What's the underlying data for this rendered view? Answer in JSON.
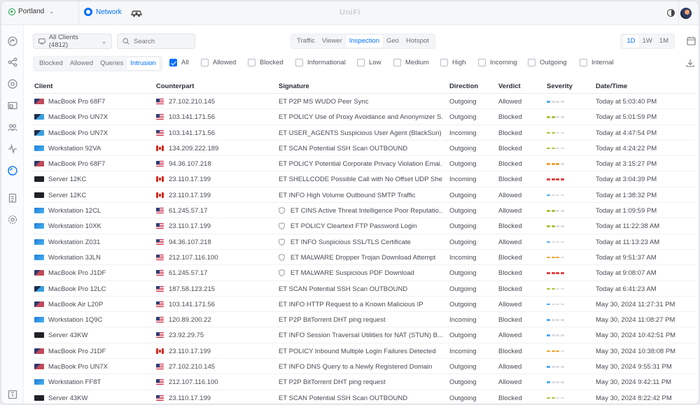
{
  "site": {
    "name": "Portland"
  },
  "app": {
    "tab_label": "Network",
    "brand": "UniFi"
  },
  "filters": {
    "clients_label": "All Clients (4812)",
    "search_placeholder": "Search",
    "main_tabs": [
      {
        "label": "Traffic",
        "active": false
      },
      {
        "label": "Viewer",
        "active": false
      },
      {
        "label": "Inspection",
        "active": true
      },
      {
        "label": "Geo",
        "active": false
      },
      {
        "label": "Hotspot",
        "active": false
      }
    ],
    "time_ranges": [
      {
        "label": "1D",
        "active": true
      },
      {
        "label": "1W",
        "active": false
      },
      {
        "label": "1M",
        "active": false
      }
    ],
    "verdict_tabs": [
      {
        "label": "Blocked",
        "active": false
      },
      {
        "label": "Allowed",
        "active": false
      },
      {
        "label": "Queries",
        "active": false
      },
      {
        "label": "Intrusion",
        "active": true
      }
    ],
    "checkboxes": [
      {
        "label": "All",
        "checked": true
      },
      {
        "label": "Allowed",
        "checked": false
      },
      {
        "label": "Blocked",
        "checked": false
      },
      {
        "label": "Informational",
        "checked": false
      },
      {
        "label": "Low",
        "checked": false
      },
      {
        "label": "Medium",
        "checked": false
      },
      {
        "label": "High",
        "checked": false
      },
      {
        "label": "Incoming",
        "checked": false
      },
      {
        "label": "Outgoing",
        "checked": false
      },
      {
        "label": "Internal",
        "checked": false
      }
    ]
  },
  "table": {
    "headers": [
      "Client",
      "Counterpart",
      "Signature",
      "Direction",
      "Verdict",
      "Severity",
      "Date/Time"
    ],
    "severity_colors": {
      "low": "#4aa8f0",
      "medium": "#a9c23c",
      "high": "#f0a02c",
      "critical": "#e23c3c",
      "empty": "#d9dde2"
    },
    "device_colors": {
      "macbook": "#b23a5a",
      "macbook_blue": "#2c6db5",
      "workstation": "#2d8fe0",
      "server": "#1f2328"
    },
    "rows": [
      {
        "client": "MacBook Pro 68F7",
        "device": "macbook",
        "flag": "us",
        "ip": "27.102.210.145",
        "shield": false,
        "signature": "ET P2P MS WUDO Peer Sync",
        "direction": "Outgoing",
        "verdict": "Allowed",
        "severity": "low",
        "time": "Today at 5:03:40 PM"
      },
      {
        "client": "MacBook Pro UN7X",
        "device": "macbook_blue",
        "flag": "us",
        "ip": "103.141.171.56",
        "shield": false,
        "signature": "ET POLICY Use of Proxy Avoidance and Anonymizer S...",
        "direction": "Outgoing",
        "verdict": "Blocked",
        "severity": "medium",
        "time": "Today at 5:01:59 PM"
      },
      {
        "client": "MacBook Pro UN7X",
        "device": "macbook_blue",
        "flag": "us",
        "ip": "103.141.171.56",
        "shield": false,
        "signature": "ET USER_AGENTS Suspicious User Agent (BlackSun)",
        "direction": "Incoming",
        "verdict": "Blocked",
        "severity": "medium",
        "time": "Today at 4:47:54 PM"
      },
      {
        "client": "Workstation 92VA",
        "device": "workstation",
        "flag": "ca",
        "ip": "134.209.222.189",
        "shield": false,
        "signature": "ET SCAN Potential SSH Scan OUTBOUND",
        "direction": "Outgoing",
        "verdict": "Blocked",
        "severity": "medium",
        "time": "Today at 4:24:22 PM"
      },
      {
        "client": "MacBook Pro 68F7",
        "device": "macbook",
        "flag": "us",
        "ip": "94.36.107.218",
        "shield": false,
        "signature": "ET POLICY Potential Corporate Privacy Violation Emai...",
        "direction": "Outgoing",
        "verdict": "Blocked",
        "severity": "high",
        "time": "Today at 3:15:27 PM"
      },
      {
        "client": "Server 12KC",
        "device": "server",
        "flag": "ca",
        "ip": "23.110.17.199",
        "shield": false,
        "signature": "ET SHELLCODE Possible Call with No Offset UDP She...",
        "direction": "Incoming",
        "verdict": "Blocked",
        "severity": "critical",
        "time": "Today at 3:04:39 PM"
      },
      {
        "client": "Server 12KC",
        "device": "server",
        "flag": "ca",
        "ip": "23.110.17.199",
        "shield": false,
        "signature": "ET INFO High Volume Outbound SMTP Traffic",
        "direction": "Outgoing",
        "verdict": "Allowed",
        "severity": "low",
        "time": "Today at 1:38:32 PM"
      },
      {
        "client": "Workstation 12CL",
        "device": "workstation",
        "flag": "us",
        "ip": "61.245.57.17",
        "shield": true,
        "signature": "ET CINS Active Threat Intelligence Poor Reputatio...",
        "direction": "Outgoing",
        "verdict": "Allowed",
        "severity": "medium",
        "time": "Today at 1:09:59 PM"
      },
      {
        "client": "Workstation 10XK",
        "device": "workstation",
        "flag": "us",
        "ip": "23.110.17.199",
        "shield": true,
        "signature": "ET POLICY Cleartext FTP Password Login",
        "direction": "Outgoing",
        "verdict": "Blocked",
        "severity": "medium",
        "time": "Today at 11:22:38 AM"
      },
      {
        "client": "Workstation Z031",
        "device": "workstation",
        "flag": "us",
        "ip": "94.36.107.218",
        "shield": true,
        "signature": "ET INFO Suspicious SSL/TLS Certificate",
        "direction": "Outgoing",
        "verdict": "Allowed",
        "severity": "low",
        "time": "Today at 11:13:23 AM"
      },
      {
        "client": "Workstation 3JLN",
        "device": "workstation",
        "flag": "us",
        "ip": "212.107.116.100",
        "shield": true,
        "signature": "ET MALWARE Dropper Trojan Download Attempt",
        "direction": "Incoming",
        "verdict": "Blocked",
        "severity": "high",
        "time": "Today at 9:51:37 AM"
      },
      {
        "client": "MacBook Pro J1DF",
        "device": "macbook",
        "flag": "us",
        "ip": "61.245.57.17",
        "shield": true,
        "signature": "ET MALWARE Suspicious PDF Download",
        "direction": "Outgoing",
        "verdict": "Blocked",
        "severity": "critical",
        "time": "Today at 9:08:07 AM"
      },
      {
        "client": "MacBook Pro 12LC",
        "device": "macbook_blue",
        "flag": "us",
        "ip": "187.58.123.215",
        "shield": false,
        "signature": "ET SCAN Potential SSH Scan OUTBOUND",
        "direction": "Outgoing",
        "verdict": "Blocked",
        "severity": "medium",
        "time": "Today at 6:41:23 AM"
      },
      {
        "client": "MacBook Air L20P",
        "device": "macbook",
        "flag": "us",
        "ip": "103.141.171.56",
        "shield": false,
        "signature": "ET INFO HTTP Request to a Known Malicious IP",
        "direction": "Outgoing",
        "verdict": "Allowed",
        "severity": "low",
        "time": "May 30, 2024 11:27:31 PM"
      },
      {
        "client": "Workstation 1Q9C",
        "device": "workstation",
        "flag": "us",
        "ip": "120.89.200.22",
        "shield": false,
        "signature": "ET P2P BitTorrent DHT ping request",
        "direction": "Incoming",
        "verdict": "Blocked",
        "severity": "low",
        "time": "May 30, 2024 11:08:27 PM"
      },
      {
        "client": "Server 43KW",
        "device": "server",
        "flag": "us",
        "ip": "23.92.29.75",
        "shield": false,
        "signature": "ET INFO Session Traversal Utilities for NAT (STUN) B...",
        "direction": "Outgoing",
        "verdict": "Allowed",
        "severity": "low",
        "time": "May 30, 2024 10:42:51 PM"
      },
      {
        "client": "MacBook Pro J1DF",
        "device": "macbook",
        "flag": "ca",
        "ip": "23.110.17.199",
        "shield": false,
        "signature": "ET POLICY Inbound Multiple Login Failures Detected",
        "direction": "Incoming",
        "verdict": "Blocked",
        "severity": "high",
        "time": "May 30, 2024 10:38:08 PM"
      },
      {
        "client": "MacBook Pro UN7X",
        "device": "macbook",
        "flag": "us",
        "ip": "27.102.210.145",
        "shield": false,
        "signature": "ET INFO DNS Query to a Newly Registered Domain",
        "direction": "Outgoing",
        "verdict": "Allowed",
        "severity": "low",
        "time": "May 30, 2024 9:55:31 PM"
      },
      {
        "client": "Workstation FF8T",
        "device": "workstation",
        "flag": "us",
        "ip": "212.107.116.100",
        "shield": false,
        "signature": "ET P2P BitTorrent DHT ping request",
        "direction": "Outgoing",
        "verdict": "Allowed",
        "severity": "low",
        "time": "May 30, 2024 9:42:11 PM"
      },
      {
        "client": "Server 43KW",
        "device": "server",
        "flag": "us",
        "ip": "23.110.17.199",
        "shield": false,
        "signature": "ET SCAN Potential SSH Scan OUTBOUND",
        "direction": "Outgoing",
        "verdict": "Blocked",
        "severity": "medium",
        "time": "May 30, 2024 8:22:42 PM"
      }
    ]
  }
}
